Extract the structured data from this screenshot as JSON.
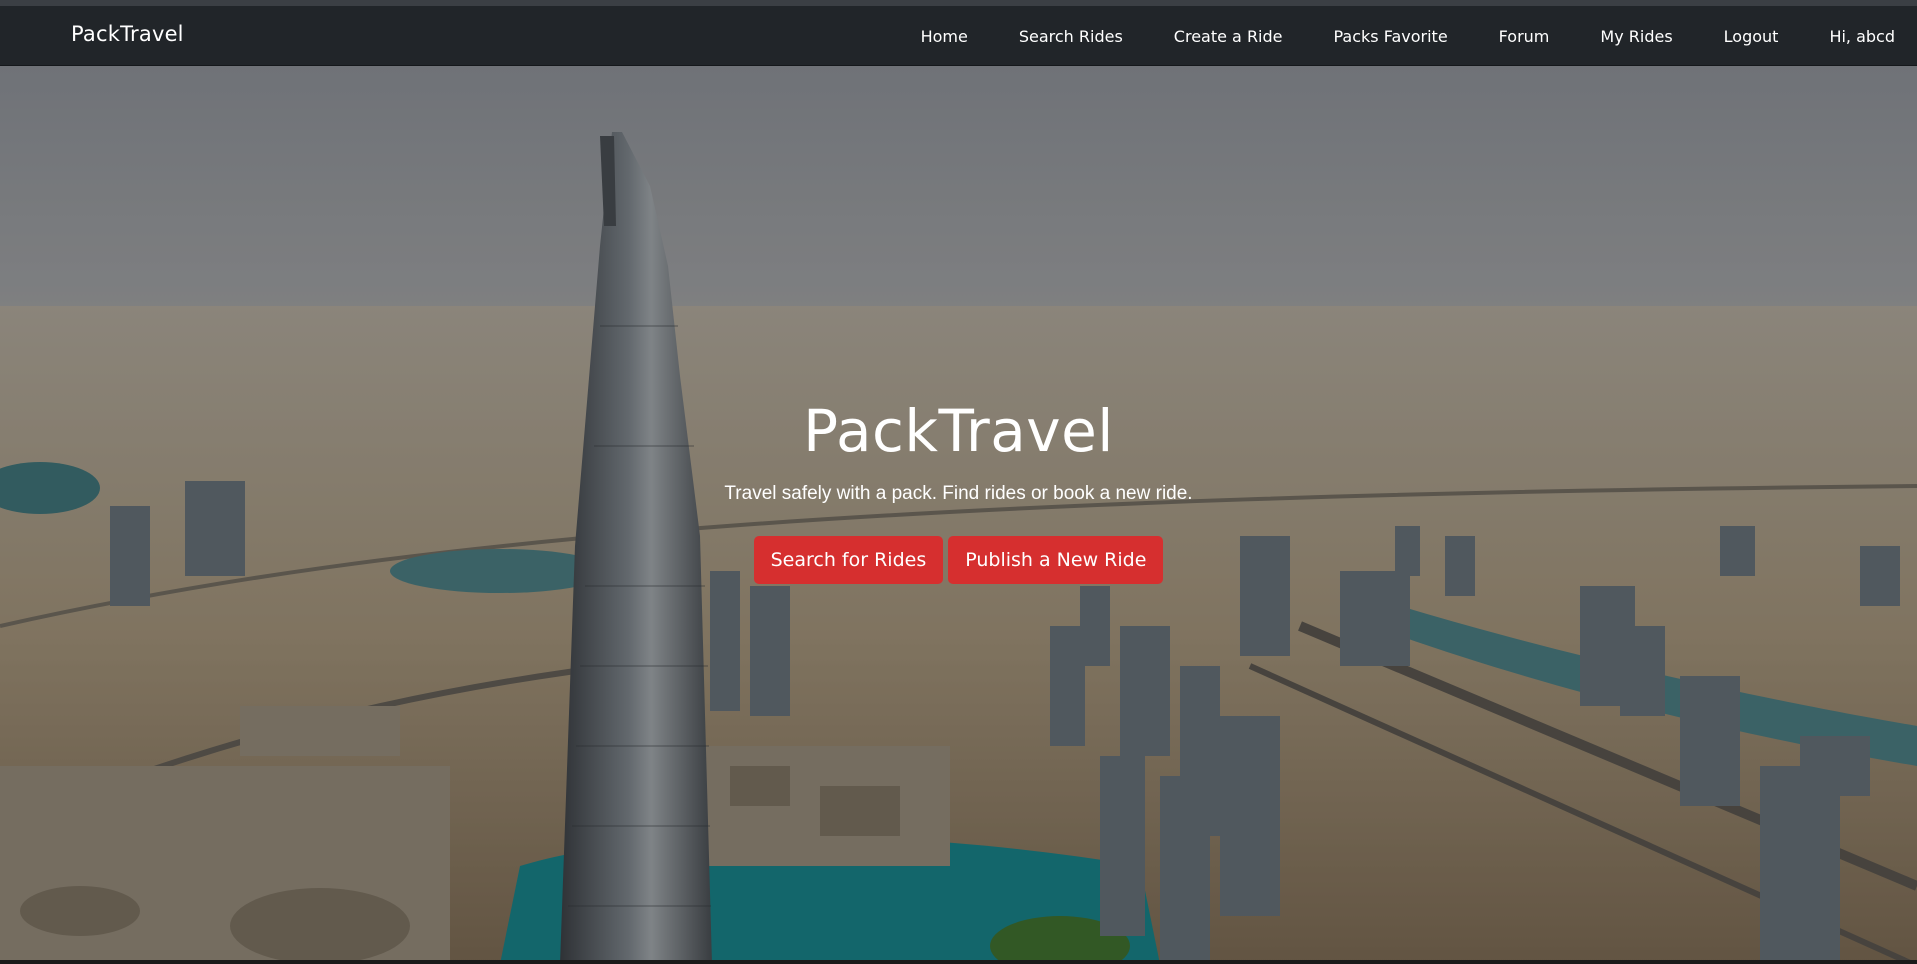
{
  "navbar": {
    "brand": "PackTravel",
    "links": [
      {
        "label": "Home"
      },
      {
        "label": "Search Rides"
      },
      {
        "label": "Create a Ride"
      },
      {
        "label": "Packs Favorite"
      },
      {
        "label": "Forum"
      },
      {
        "label": "My Rides"
      },
      {
        "label": "Logout"
      },
      {
        "label": "Hi, abcd"
      }
    ]
  },
  "hero": {
    "title": "PackTravel",
    "subtitle": "Travel safely with a pack. Find rides or book a new ride.",
    "buttons": {
      "search": "Search for Rides",
      "publish": "Publish a New Ride"
    }
  },
  "colors": {
    "navbar_bg": "#212529",
    "button_bg": "#d62f2f",
    "text": "#ffffff"
  }
}
